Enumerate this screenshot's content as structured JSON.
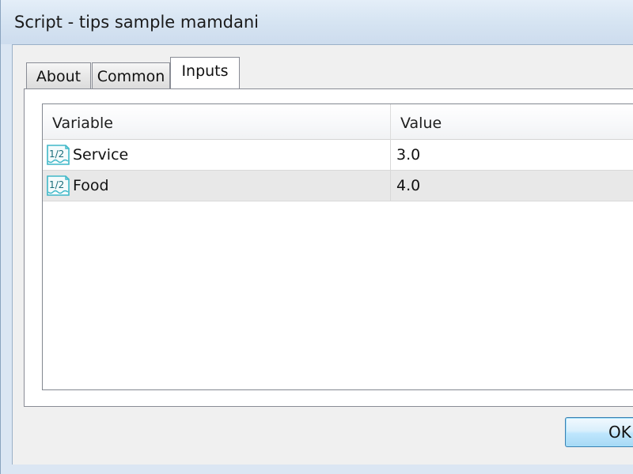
{
  "window": {
    "title": "Script - tips sample mamdani"
  },
  "tabs": [
    {
      "label": "About",
      "active": false
    },
    {
      "label": "Common",
      "active": false
    },
    {
      "label": "Inputs",
      "active": true
    }
  ],
  "inputs_table": {
    "columns": [
      "Variable",
      "Value"
    ],
    "rows": [
      {
        "variable": "Service",
        "value": "3.0",
        "icon": "fraction-variable-icon"
      },
      {
        "variable": "Food",
        "value": "4.0",
        "icon": "fraction-variable-icon"
      }
    ]
  },
  "buttons": {
    "ok_label": "OK"
  },
  "colors": {
    "title_bar": "#d6e4f2",
    "dialog_bg": "#f0f0f0",
    "alt_row": "#e8e8e8",
    "icon_accent": "#3fb8c8"
  }
}
